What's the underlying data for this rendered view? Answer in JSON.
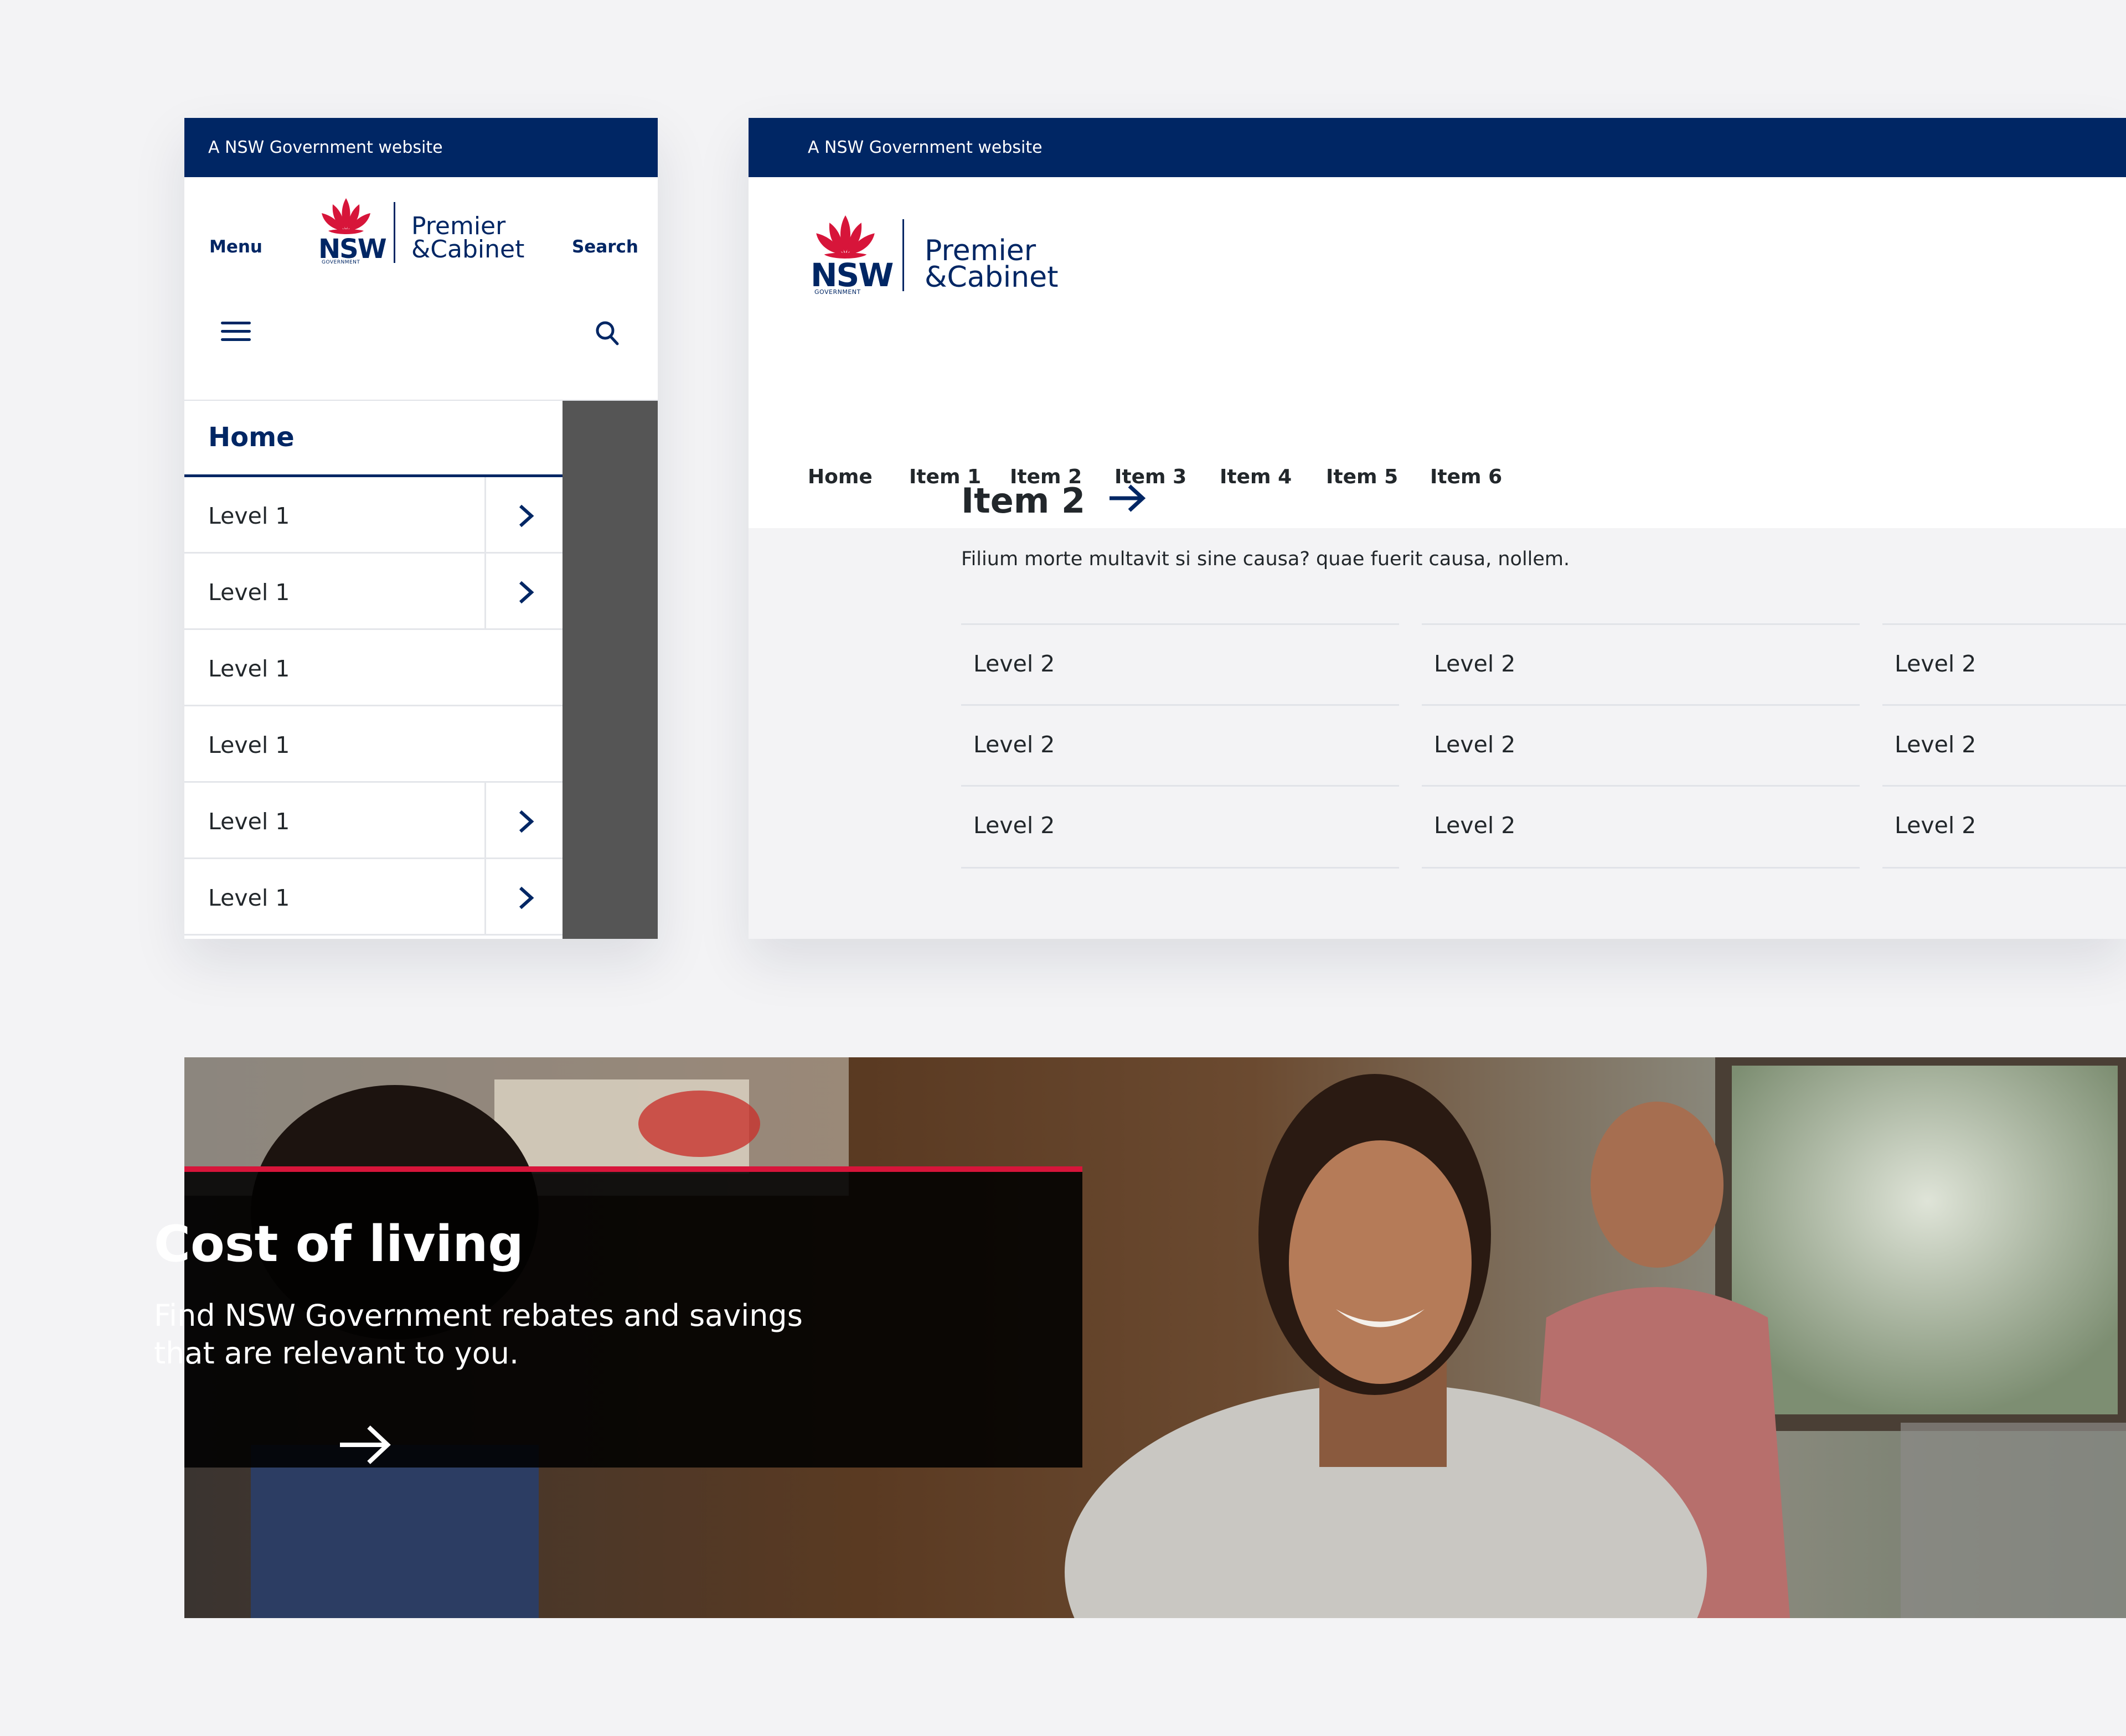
{
  "gov_banner": "A NSW Government website",
  "logo": {
    "nsw": "NSW",
    "government": "GOVERNMENT",
    "line1": "Premier",
    "line2": "&Cabinet"
  },
  "mobile": {
    "menu_label": "Menu",
    "search_label": "Search",
    "nav": {
      "home": "Home",
      "items": [
        {
          "label": "Level 1",
          "has_children": true
        },
        {
          "label": "Level 1",
          "has_children": true
        },
        {
          "label": "Level 1",
          "has_children": false
        },
        {
          "label": "Level 1",
          "has_children": false
        },
        {
          "label": "Level 1",
          "has_children": true
        },
        {
          "label": "Level 1",
          "has_children": true
        }
      ]
    }
  },
  "desktop": {
    "nav": [
      "Home",
      "Item 1",
      "Item 2",
      "Item 3",
      "Item 4",
      "Item 5",
      "Item 6"
    ],
    "mega_menu": {
      "title": "Item 2",
      "description": "Filium morte multavit si sine causa? quae fuerit causa, nollem.",
      "columns": [
        [
          "Level 2",
          "Level 2",
          "Level 2"
        ],
        [
          "Level 2",
          "Level 2",
          "Level 2"
        ],
        [
          "Level 2",
          "Level 2",
          "Level 2"
        ]
      ]
    }
  },
  "hero": {
    "title": "Cost of living",
    "text": "Find NSW Government rebates and savings that are relevant to you."
  },
  "colors": {
    "navy": "#002664",
    "red": "#d7153a",
    "background": "#f3f3f5",
    "overlay": "#555555"
  },
  "icons": [
    "hamburger-icon",
    "search-icon",
    "chevron-right-icon",
    "arrow-right-icon",
    "waratah-logo-icon"
  ]
}
